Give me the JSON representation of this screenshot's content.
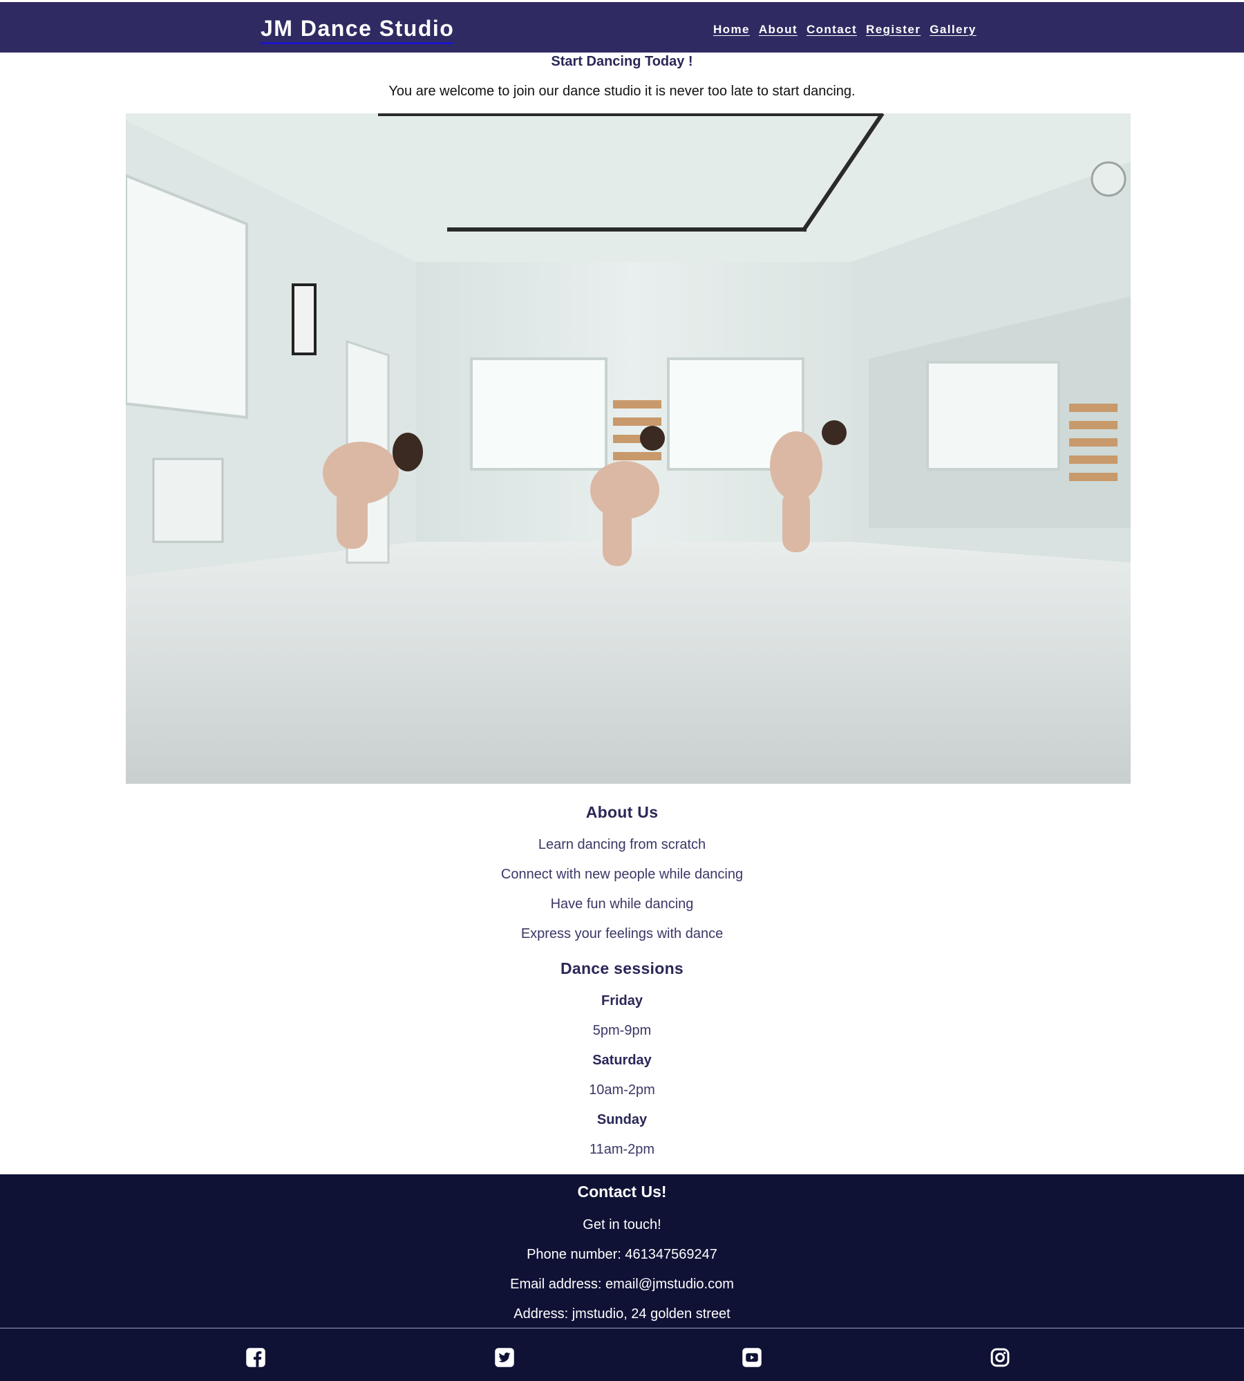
{
  "header": {
    "brand": "JM Dance Studio",
    "nav": [
      "Home",
      "About",
      "Contact",
      "Register",
      "Gallery"
    ]
  },
  "intro": {
    "title": "Start Dancing Today !",
    "text": "You are welcome to join our dance studio it is never too late to start dancing."
  },
  "about": {
    "title": "About Us",
    "items": [
      "Learn dancing from scratch",
      "Connect with new people while dancing",
      "Have fun while dancing",
      "Express your feelings with dance"
    ]
  },
  "sessions": {
    "title": "Dance sessions",
    "days": [
      {
        "day": "Friday",
        "time": "5pm-9pm"
      },
      {
        "day": "Saturday",
        "time": "10am-2pm"
      },
      {
        "day": "Sunday",
        "time": "11am-2pm"
      }
    ]
  },
  "footer": {
    "title": "Contact Us!",
    "lines": [
      "Get in touch!",
      "Phone number: 461347569247",
      "Email address: email@jmstudio.com",
      "Address: jmstudio, 24 golden street"
    ],
    "social_icons": [
      "facebook-icon",
      "twitter-icon",
      "youtube-icon",
      "instagram-icon"
    ]
  },
  "colors": {
    "header_bg": "#2f2b62",
    "footer_bg": "#0f1235",
    "heading": "#2a2757"
  }
}
